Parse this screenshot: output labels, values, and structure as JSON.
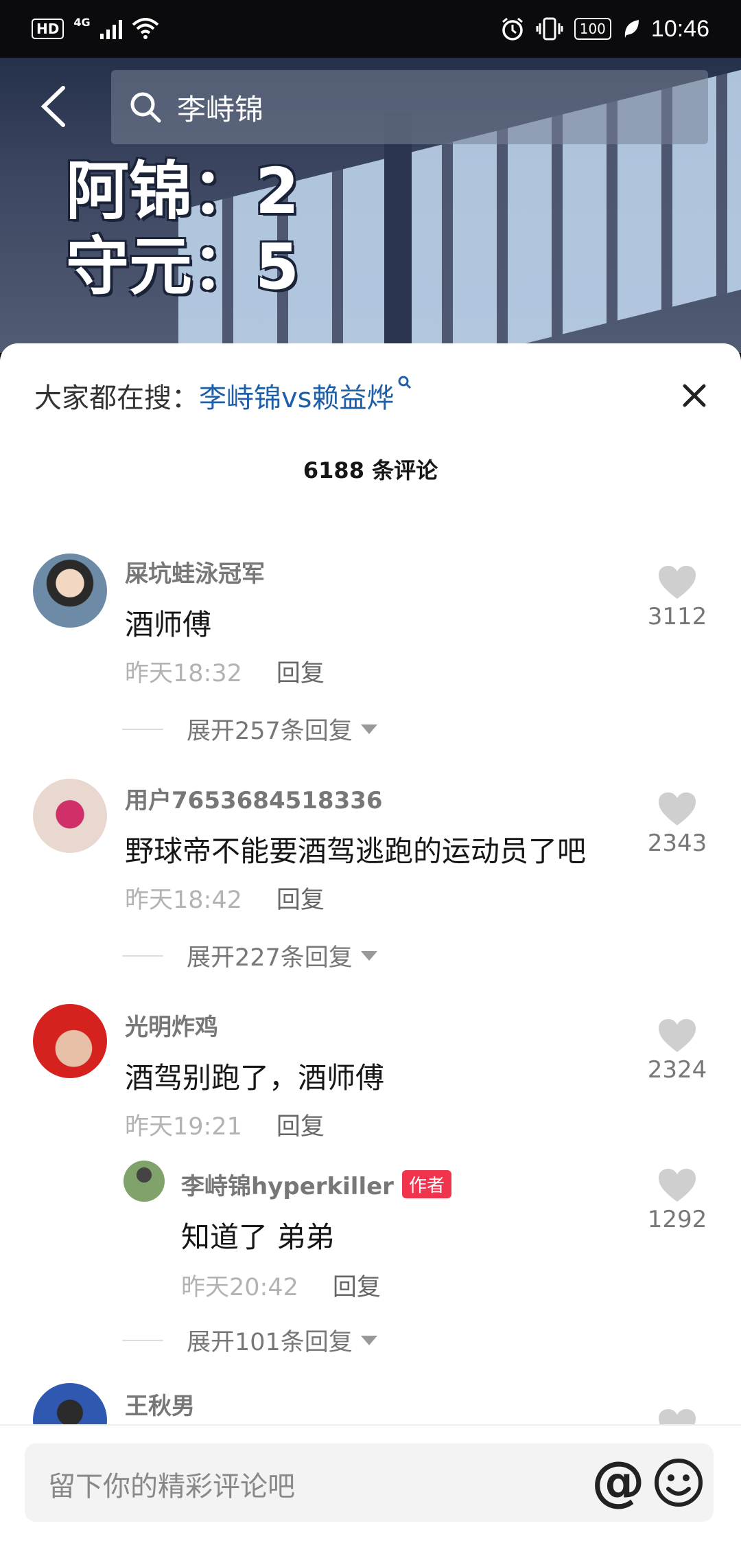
{
  "status_bar": {
    "hd": "HD",
    "network": "4G",
    "battery": "100",
    "time": "10:46"
  },
  "video": {
    "score_line_1": "阿锦：2",
    "score_line_2": "守元：5"
  },
  "search": {
    "query": "李峙锦"
  },
  "hot_search": {
    "label": "大家都在搜：",
    "term": "李峙锦vs赖益烨"
  },
  "comments_header": {
    "count_label": "6188 条评论"
  },
  "comments": [
    {
      "user": "屎坑蛙泳冠军",
      "text": "酒师傅",
      "time": "昨天18:32",
      "reply_label": "回复",
      "likes": "3112",
      "expand_label": "展开257条回复"
    },
    {
      "user": "用户7653684518336",
      "text": "野球帝不能要酒驾逃跑的运动员了吧",
      "time": "昨天18:42",
      "reply_label": "回复",
      "likes": "2343",
      "expand_label": "展开227条回复"
    },
    {
      "user": "光明炸鸡",
      "text": "酒驾别跑了，酒师傅",
      "time": "昨天19:21",
      "reply_label": "回复",
      "likes": "2324",
      "reply": {
        "user": "李峙锦hyperkiller",
        "badge": "作者",
        "text": "知道了 弟弟",
        "time": "昨天20:42",
        "reply_label": "回复",
        "likes": "1292"
      },
      "expand_label": "展开101条回复"
    },
    {
      "user": "王秋男"
    }
  ],
  "input": {
    "placeholder": "留下你的精彩评论吧",
    "at_symbol": "@"
  },
  "colors": {
    "link": "#1f5fa8",
    "author_badge": "#f0344e",
    "like_icon": "#cfcfcf"
  }
}
